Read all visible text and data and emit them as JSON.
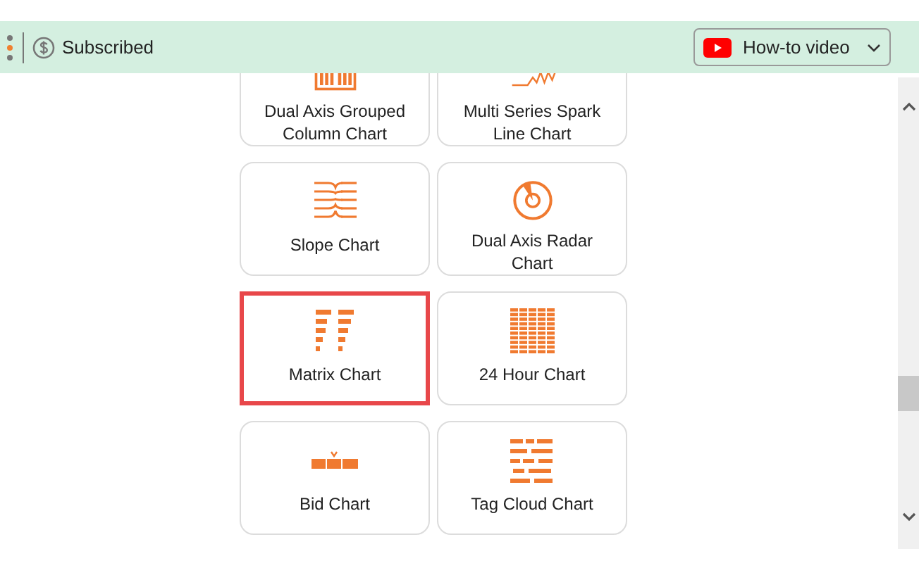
{
  "header": {
    "subscription": "Subscribed",
    "video_button": "How-to video"
  },
  "cards": [
    {
      "label": "Dual Axis Grouped Column Chart",
      "selected": false
    },
    {
      "label": "Multi Series Spark Line Chart",
      "selected": false
    },
    {
      "label": "Slope Chart",
      "selected": false
    },
    {
      "label": "Dual Axis Radar Chart",
      "selected": false
    },
    {
      "label": "Matrix Chart",
      "selected": true
    },
    {
      "label": "24 Hour Chart",
      "selected": false
    },
    {
      "label": "Bid Chart",
      "selected": false
    },
    {
      "label": "Tag Cloud Chart",
      "selected": false
    }
  ]
}
